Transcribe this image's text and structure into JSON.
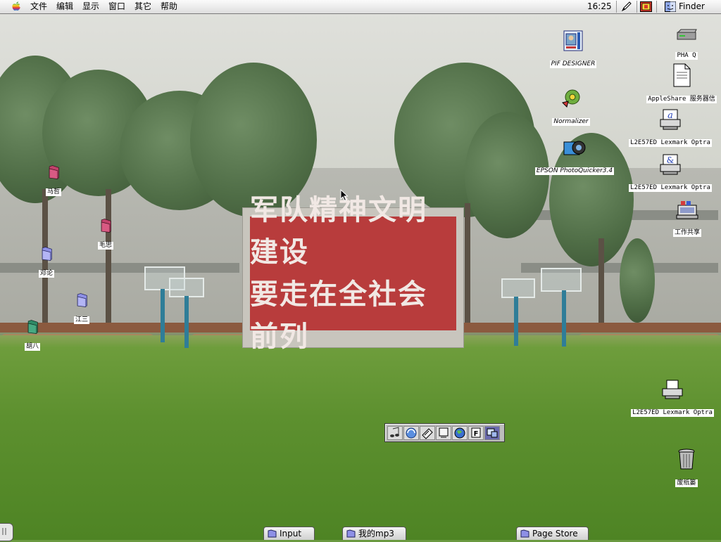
{
  "menubar": {
    "menus": [
      "文件",
      "编辑",
      "显示",
      "窗口",
      "其它",
      "帮助"
    ],
    "clock": "16:25",
    "app": "Finder"
  },
  "wallpaper": {
    "billboard_line1": "军队精神文明建设",
    "billboard_line2": "要走在全社会前列"
  },
  "desktop_right": [
    {
      "label": "PIF DESIGNER",
      "icon": "pif-designer-app-icon"
    },
    {
      "label": "PHA Q",
      "icon": "hard-disk-icon"
    },
    {
      "label": "Normalizer",
      "icon": "normalizer-app-icon"
    },
    {
      "label": "AppleShare 服务器信",
      "icon": "document-icon"
    },
    {
      "label": "EPSON PhotoQuicker3.4",
      "icon": "epson-camera-icon"
    },
    {
      "label": "L2E57ED Lexmark Optra",
      "icon": "desktop-printer-icon"
    },
    {
      "label": "L2E57ED Lexmark Optra",
      "icon": "desktop-printer-icon"
    },
    {
      "label": "工作共享",
      "icon": "file-sharing-icon"
    },
    {
      "label": "L2E57ED Lexmark Optra",
      "icon": "desktop-printer-icon"
    },
    {
      "label": "废纸篓",
      "icon": "trash-icon"
    }
  ],
  "desktop_left": [
    {
      "label": "马哲",
      "color": "#c2426b"
    },
    {
      "label": "毛思",
      "color": "#c2426b"
    },
    {
      "label": "邓论",
      "color": "#9a9cf0"
    },
    {
      "label": "江三",
      "color": "#9a9cf0"
    },
    {
      "label": "胡八",
      "color": "#3d9b78"
    }
  ],
  "control_strip": {
    "icons": [
      "sound-icon",
      "appletalk-icon",
      "apple-cd-icon",
      "monitor-icon",
      "internet-icon",
      "text-icon",
      "remote-access-icon"
    ]
  },
  "tabs": {
    "input": "Input",
    "mp3": "我的mp3",
    "page_store": "Page Store"
  },
  "colors": {
    "billboard": "#b83c3c",
    "menubar": "#efefef"
  }
}
